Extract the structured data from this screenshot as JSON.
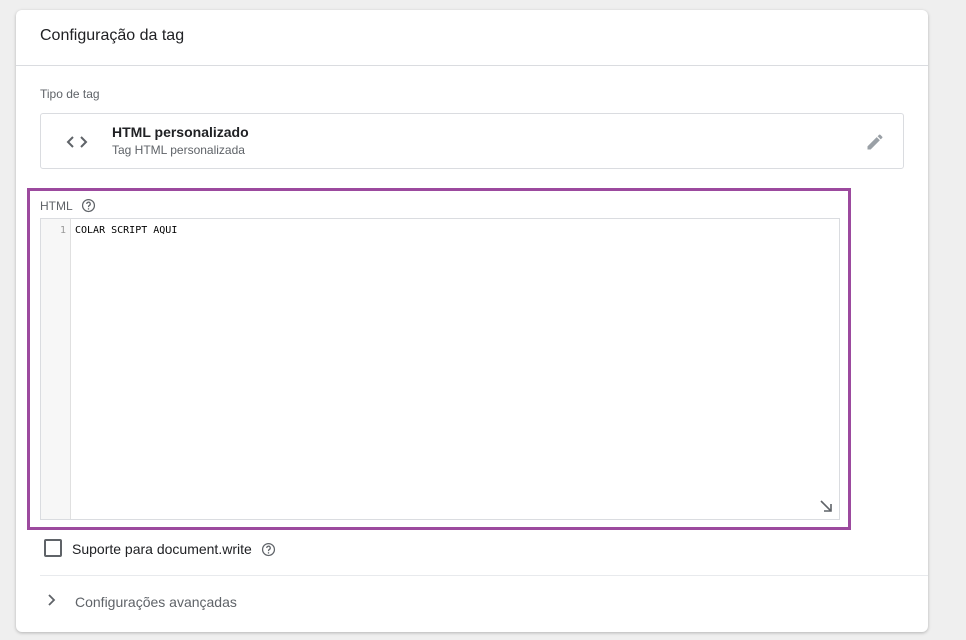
{
  "card": {
    "title": "Configuração da tag"
  },
  "tag_type": {
    "section_label": "Tipo de tag",
    "name": "HTML personalizado",
    "subtitle": "Tag HTML personalizada",
    "icon": "code-icon"
  },
  "html_field": {
    "label": "HTML",
    "line_number": "1",
    "code": "COLAR SCRIPT AQUI"
  },
  "document_write": {
    "label": "Suporte para document.write",
    "checked": false
  },
  "advanced": {
    "label": "Configurações avançadas"
  },
  "colors": {
    "highlight": "#9c4a9e",
    "text_secondary": "#5f6368"
  }
}
